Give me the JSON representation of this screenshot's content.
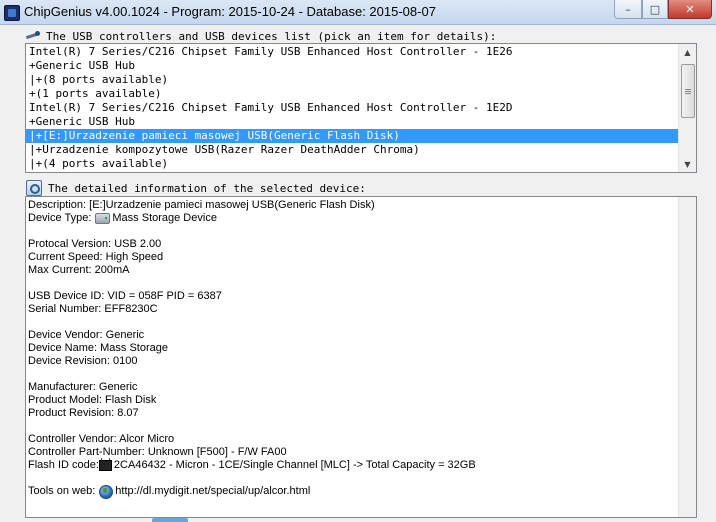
{
  "window": {
    "title": "ChipGenius v4.00.1024 - Program: 2015-10-24 - Database: 2015-08-07",
    "minimize_glyph": "–",
    "maximize_glyph": "□",
    "close_glyph": "✕"
  },
  "device_list": {
    "label": "The USB controllers and USB devices list (pick an item for details):",
    "icon": "usb-icon",
    "items": [
      "Intel(R) 7 Series/C216 Chipset Family USB Enhanced Host Controller - 1E26",
      "+Generic USB Hub",
      "|+(8 ports available)",
      "+(1 ports available)",
      "Intel(R) 7 Series/C216 Chipset Family USB Enhanced Host Controller - 1E2D",
      "+Generic USB Hub",
      "|+[E:]Urzadzenie pamieci masowej USB(Generic Flash Disk)",
      "|+Urzadzenie kompozytowe USB(Razer Razer DeathAdder Chroma)",
      "|+(4 ports available)"
    ],
    "selected_index": 6,
    "scroll_up_glyph": "▲",
    "scroll_down_glyph": "▼"
  },
  "details": {
    "label": "The detailed information of the selected device:",
    "icon": "info-icon",
    "description": "Description: [E:]Urzadzenie pamieci masowej USB(Generic Flash Disk)",
    "device_type_label": "Device Type:",
    "device_type_value": "Mass Storage Device",
    "protocol_version": "Protocal Version: USB 2.00",
    "current_speed": "Current Speed: High Speed",
    "max_current": "Max Current: 200mA",
    "usb_device_id": "USB Device ID: VID = 058F PID = 6387",
    "serial_number": "Serial Number: EFF8230C",
    "device_vendor": "Device Vendor: Generic",
    "device_name": "Device Name: Mass Storage",
    "device_revision": "Device Revision: 0100",
    "manufacturer": "Manufacturer: Generic",
    "product_model": "Product Model: Flash Disk",
    "product_revision": "Product Revision: 8.07",
    "controller_vendor": "Controller Vendor: Alcor Micro",
    "controller_part_number": "Controller Part-Number: Unknown [F500] - F/W FA00",
    "flash_id_label": "Flash ID code:",
    "flash_id_value": "2CA46432 - Micron - 1CE/Single Channel [MLC] -> Total Capacity = 32GB",
    "tools_label": "Tools on web:",
    "tools_url": "http://dl.mydigit.net/special/up/alcor.html"
  }
}
